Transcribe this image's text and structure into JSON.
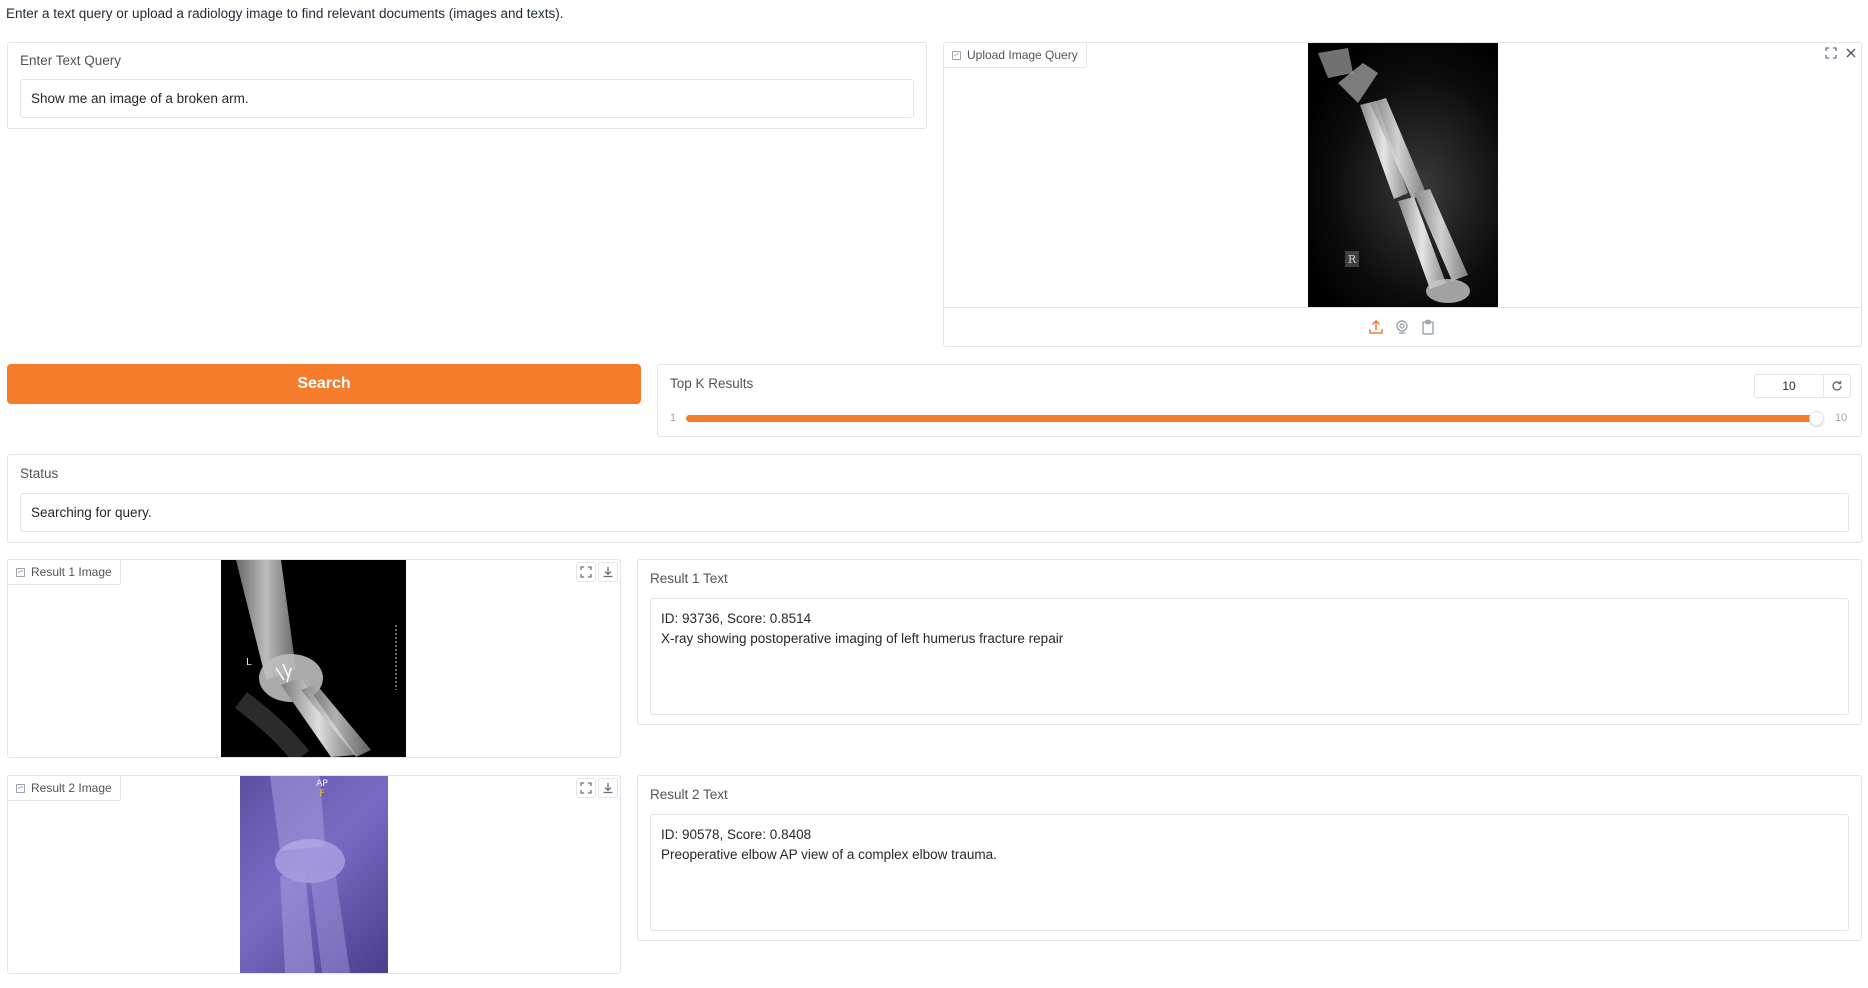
{
  "intro": "Enter a text query or upload a radiology image to find relevant documents (images and texts).",
  "text_query": {
    "label": "Enter Text Query",
    "value": "Show me an image of a broken arm."
  },
  "image_query": {
    "label": "Upload Image Query",
    "xray_marker": "R"
  },
  "search_button": "Search",
  "top_k": {
    "label": "Top K Results",
    "value": "10",
    "min": "1",
    "max": "10",
    "fill_fraction": 1.0
  },
  "status": {
    "label": "Status",
    "value": "Searching for query."
  },
  "results": [
    {
      "image_label": "Result 1 Image",
      "image_marker": "L",
      "text_label": "Result 1 Text",
      "line1": "ID: 93736, Score: 0.8514",
      "line2": "X-ray showing postoperative imaging of left humerus fracture repair"
    },
    {
      "image_label": "Result 2 Image",
      "image_marker_top": "AP",
      "image_marker_sub": "F",
      "text_label": "Result 2 Text",
      "line1": "ID: 90578, Score: 0.8408",
      "line2": "Preoperative elbow AP view of a complex elbow trauma."
    }
  ],
  "colors": {
    "accent": "#f47c2b",
    "border": "#e4e4e7"
  }
}
